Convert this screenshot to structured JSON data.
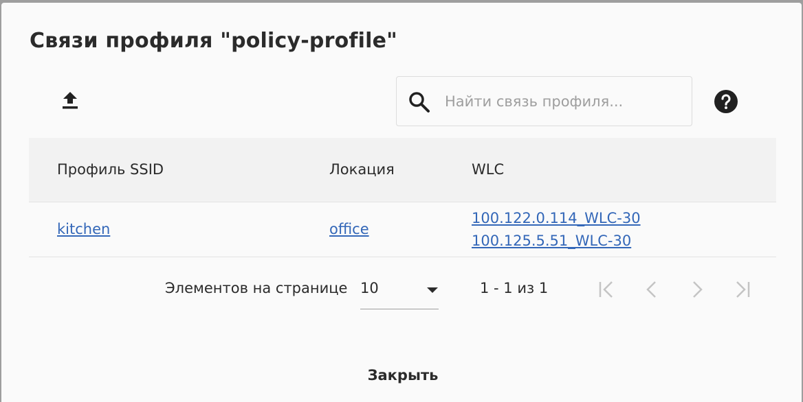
{
  "dialog": {
    "title": "Связи профиля \"policy-profile\"",
    "search": {
      "placeholder": "Найти связь профиля...",
      "value": ""
    },
    "icons": {
      "export": "upload-icon",
      "search": "search-icon",
      "help": "help-circle-icon"
    }
  },
  "table": {
    "columns": [
      "Профиль SSID",
      "Локация",
      "WLC"
    ],
    "rows": [
      {
        "ssid_profile": "kitchen",
        "location": "office",
        "wlc": [
          "100.122.0.114_WLC-30",
          "100.125.5.51_WLC-30"
        ]
      }
    ]
  },
  "pagination": {
    "items_per_page_label": "Элементов на странице",
    "items_per_page": "10",
    "range": "1 - 1 из 1"
  },
  "footer": {
    "close_label": "Закрыть"
  },
  "colors": {
    "link": "#3367b8",
    "text": "#2b2b2b",
    "disabled": "#c4c4c4",
    "background": "#fafafa"
  }
}
